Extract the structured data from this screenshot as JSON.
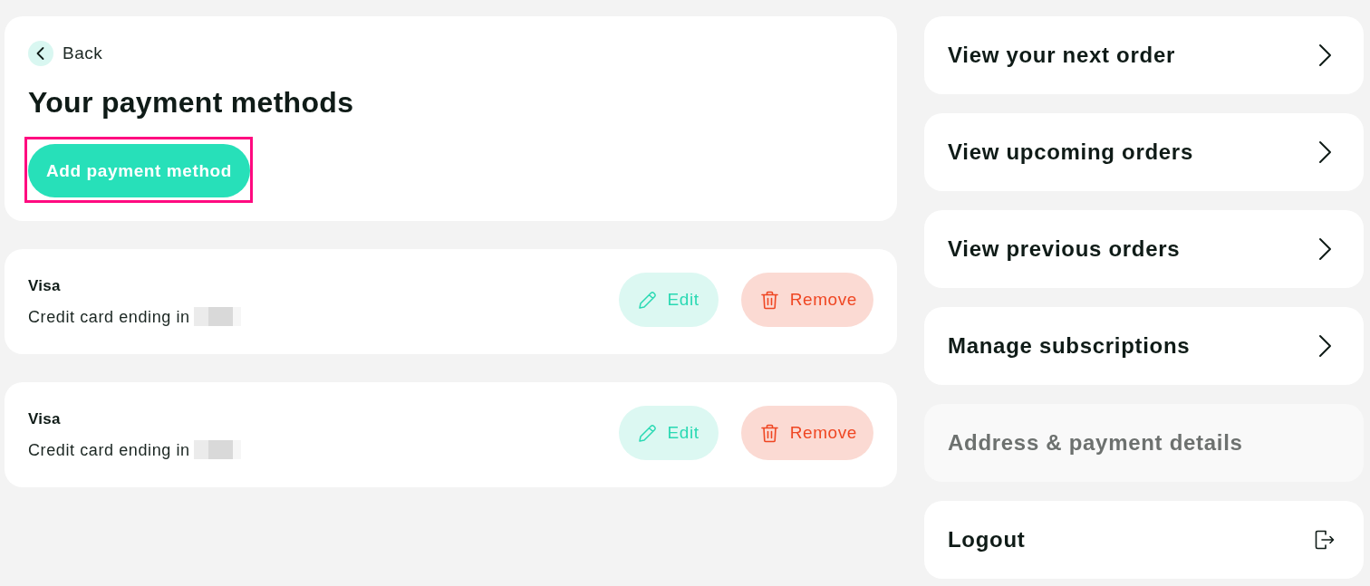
{
  "back": {
    "label": "Back"
  },
  "title": "Your payment methods",
  "add_button": {
    "label": "Add payment method",
    "focused": true
  },
  "payment_methods": [
    {
      "brand": "Visa",
      "description": "Credit card ending in",
      "number_masked": true,
      "edit_label": "Edit",
      "remove_label": "Remove"
    },
    {
      "brand": "Visa",
      "description": "Credit card ending in",
      "number_masked": true,
      "edit_label": "Edit",
      "remove_label": "Remove"
    }
  ],
  "nav": [
    {
      "label": "View your next order",
      "kind": "link",
      "selected": false
    },
    {
      "label": "View upcoming orders",
      "kind": "link",
      "selected": false
    },
    {
      "label": "View previous orders",
      "kind": "link",
      "selected": false
    },
    {
      "label": "Manage subscriptions",
      "kind": "link",
      "selected": false
    },
    {
      "label": "Address & payment details",
      "kind": "link",
      "selected": true
    },
    {
      "label": "Logout",
      "kind": "logout",
      "selected": false
    }
  ]
}
